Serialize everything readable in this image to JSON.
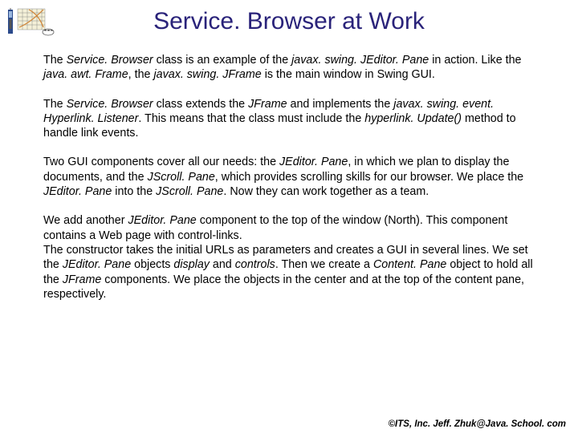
{
  "title": "Service. Browser at Work",
  "p1": {
    "t1": "The ",
    "i1": "Service. Browser",
    "t2": " class is an example of the ",
    "i2": "javax. swing. JEditor. Pane",
    "t3": " in action. Like the ",
    "i3": "java. awt. Frame",
    "t4": ", the ",
    "i4": "javax. swing. JFrame",
    "t5": " is the main window in Swing GUI."
  },
  "p2": {
    "t1": "The ",
    "i1": "Service. Browser",
    "t2": " class extends the ",
    "i2": "JFrame",
    "t3": " and implements the ",
    "i3": "javax. swing. event. Hyperlink. Listener",
    "t4": ". This means that the class must include the ",
    "i4": "hyperlink. Update()",
    "t5": " method to handle link events."
  },
  "p3": {
    "t1": "Two GUI components cover all our needs: the ",
    "i1": "JEditor. Pane",
    "t2": ", in which we plan to display the documents, and the ",
    "i2": "JScroll. Pane",
    "t3": ", which provides scrolling skills for our browser. We place the ",
    "i3": "JEditor. Pane",
    "t4": " into the ",
    "i4": "JScroll. Pane",
    "t5": ". Now they can work together as a team."
  },
  "p4": {
    "t1": "We add another ",
    "i1": "JEditor. Pane",
    "t2": " component to the top of the window (North). This component contains a Web page with control-links.",
    "t3": "The constructor takes the initial URLs as parameters and creates a GUI in several lines. We set the ",
    "i2": "JEditor. Pane",
    "t4": " objects ",
    "i3": "display",
    "t5": " and ",
    "i4": "controls",
    "t6": ". Then we create a ",
    "i5": "Content. Pane",
    "t7": " object to hold all the ",
    "i6": "JFrame",
    "t8": " components. We place the objects in the center and at the top of the content pane, respectively."
  },
  "footer": "©ITS, Inc. Jeff. Zhuk@Java. School. com"
}
